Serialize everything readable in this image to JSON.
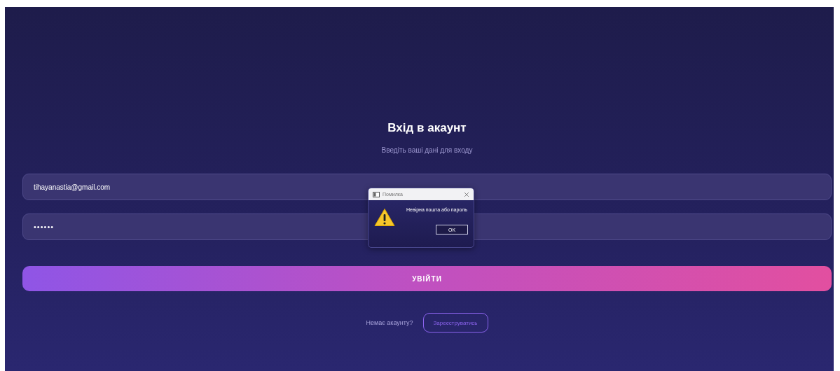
{
  "title": "Вхід в акаунт",
  "subtitle": "Введіть ваші дані для входу",
  "email_field": {
    "value": "tihayanastia@gmail.com"
  },
  "password_field": {
    "value": "••••••"
  },
  "login_button": "УВІЙТИ",
  "register_prompt": "Немає акаунту?",
  "register_button": "Зареєструватись",
  "dialog": {
    "title": "Помилка",
    "message": "Невірна пошта або пароль",
    "ok_button": "OK"
  }
}
